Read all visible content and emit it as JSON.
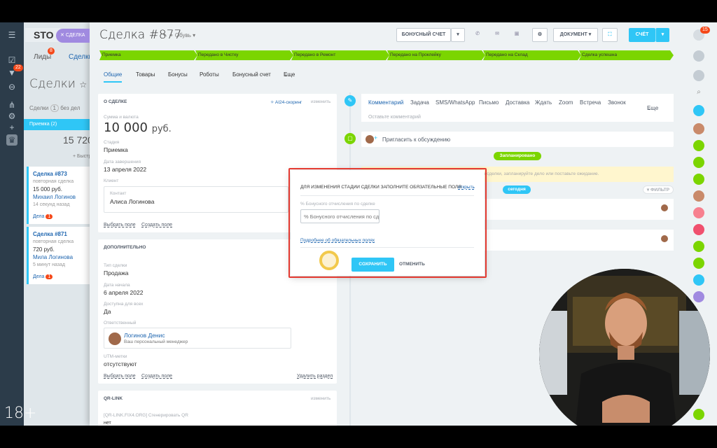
{
  "background": {
    "logo_text": "STO",
    "close_pill": "СДЕЛКА",
    "tabs": [
      "Лиды",
      "Сделки"
    ],
    "tab_badge": "8",
    "page_title": "Сделки",
    "filter_label": "Сделки",
    "filter_count": "1",
    "filter_text": "без дел",
    "stage_name": "Приемка",
    "stage_count": "(2)",
    "stage_sum": "15 720",
    "quick_add": "+ Быстра",
    "cards": [
      {
        "title": "Сделка #873",
        "type": "повторная сделка",
        "sum": "15 000 руб.",
        "person": "Михаил Логинов",
        "time": "14 секунд назад",
        "acts": "Дела",
        "acts_count": "1"
      },
      {
        "title": "Сделка #871",
        "type": "повторная сделка",
        "sum": "720 руб.",
        "person": "Мила Логинова",
        "time": "5 минут назад",
        "acts": "Дела",
        "acts_count": "1"
      }
    ]
  },
  "leftnav": {
    "badge": "22"
  },
  "age_rating": "18+",
  "deal": {
    "title": "Сделка #877",
    "category": "Обувь",
    "buttons": {
      "bonus_invoice": "БОНУСНЫЙ СЧЕТ",
      "document": "ДОКУМЕНТ",
      "invoice": "СЧЁТ"
    },
    "stages": [
      "Приемка",
      "Передано в Чистку",
      "Передано в Ремонт",
      "Передано на Проклейку",
      "Передано на Склад",
      "Сделка успешна"
    ],
    "tabs": [
      "Общие",
      "Товары",
      "Бонусы",
      "Роботы",
      "Бонусный счет",
      "Еще"
    ],
    "about": {
      "header": "О СДЕЛКЕ",
      "scoring": "AI24-скоринг",
      "edit": "изменить",
      "sum_label": "Сумма и валюта",
      "sum_value": "10 000",
      "currency": "руб.",
      "stage_label": "Стадия",
      "stage_value": "Приемка",
      "close_label": "Дата завершения",
      "close_value": "13 апреля 2022",
      "client_label": "Клиент",
      "contact_label": "Контакт",
      "contact_value": "Алиса Логинова",
      "choose_field": "Выбрать поле",
      "create_field": "Создать поле"
    },
    "extra": {
      "header": "ДОПОЛНИТЕЛЬНО",
      "type_label": "Тип сделки",
      "type_value": "Продажа",
      "start_label": "Дата начала",
      "start_value": "6 апреля 2022",
      "access_label": "Доступна для всех",
      "access_value": "Да",
      "resp_label": "Ответственный",
      "resp_name": "Логинов Денис",
      "resp_role": "Ваш персональный менеджер",
      "utm_label": "UTM-метки",
      "utm_value": "отсутствуют",
      "choose_field": "Выбрать поле",
      "create_field": "Создать поле",
      "delete_section": "Удалить раздел"
    },
    "qr": {
      "header": "QR-LINK",
      "edit": "изменить",
      "text": "[QR-LINK.FIX4.ORG] Сгенерировать QR",
      "tail": "нет"
    }
  },
  "timeline": {
    "tabs": [
      "Комментарий",
      "Задача",
      "SMS/WhatsApp",
      "Письмо",
      "Доставка",
      "Ждать",
      "Zoom",
      "Встреча",
      "Звонок",
      "Еще"
    ],
    "comment_placeholder": "Оставьте комментарий",
    "invite": "Пригласить к обсуждению",
    "planned": "Запланировано",
    "no_plans": "У вас нет запланированных дел. Передвиньте стадию сделки, запланируйте дело или поставьте ожидание.",
    "today": "сегодня",
    "filter": "ФИЛЬТР"
  },
  "modal": {
    "title": "ДЛЯ ИЗМЕНЕНИЯ СТАДИИ СДЕЛКИ ЗАПОЛНИТЕ ОБЯЗАТЕЛЬНЫЕ ПОЛЯ",
    "open": "открыть",
    "field_label": "% Бонусного отчисления по сделке",
    "field_placeholder": "% Бонусного отчисления по сделке",
    "more_link": "Подробнее об обязательных полях",
    "save": "СОХРАНИТЬ",
    "cancel": "ОТМЕНИТЬ"
  },
  "rightbar": {
    "badge": "15"
  },
  "colors": {
    "stage_green": "#7bd500",
    "accent_blue": "#2fc6f6",
    "modal_outline": "#e53b32"
  }
}
